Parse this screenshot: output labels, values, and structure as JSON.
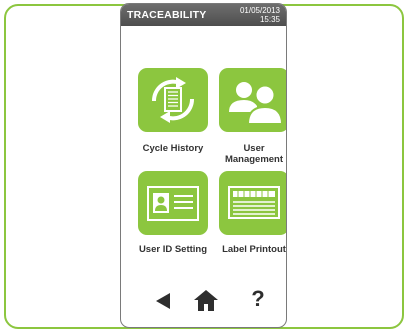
{
  "status_bar": {
    "title": "TRACEABILITY",
    "date": "01/05/2013",
    "time": "15:35"
  },
  "tiles": [
    {
      "label": "Cycle History",
      "icon": "cycle-history-icon"
    },
    {
      "label": "User Management",
      "label_line1": "User",
      "label_line2": "Management",
      "icon": "user-group-icon"
    },
    {
      "label": "User ID Setting",
      "icon": "id-card-icon"
    },
    {
      "label": "Label Printout",
      "icon": "label-printer-icon"
    }
  ],
  "nav": {
    "back_icon": "back-arrow-icon",
    "home_icon": "home-icon",
    "help_label": "?"
  },
  "colors": {
    "accent": "#8cc63f",
    "status_bar": "#5a5a5a",
    "nav_icons": "#2e2e2e"
  }
}
